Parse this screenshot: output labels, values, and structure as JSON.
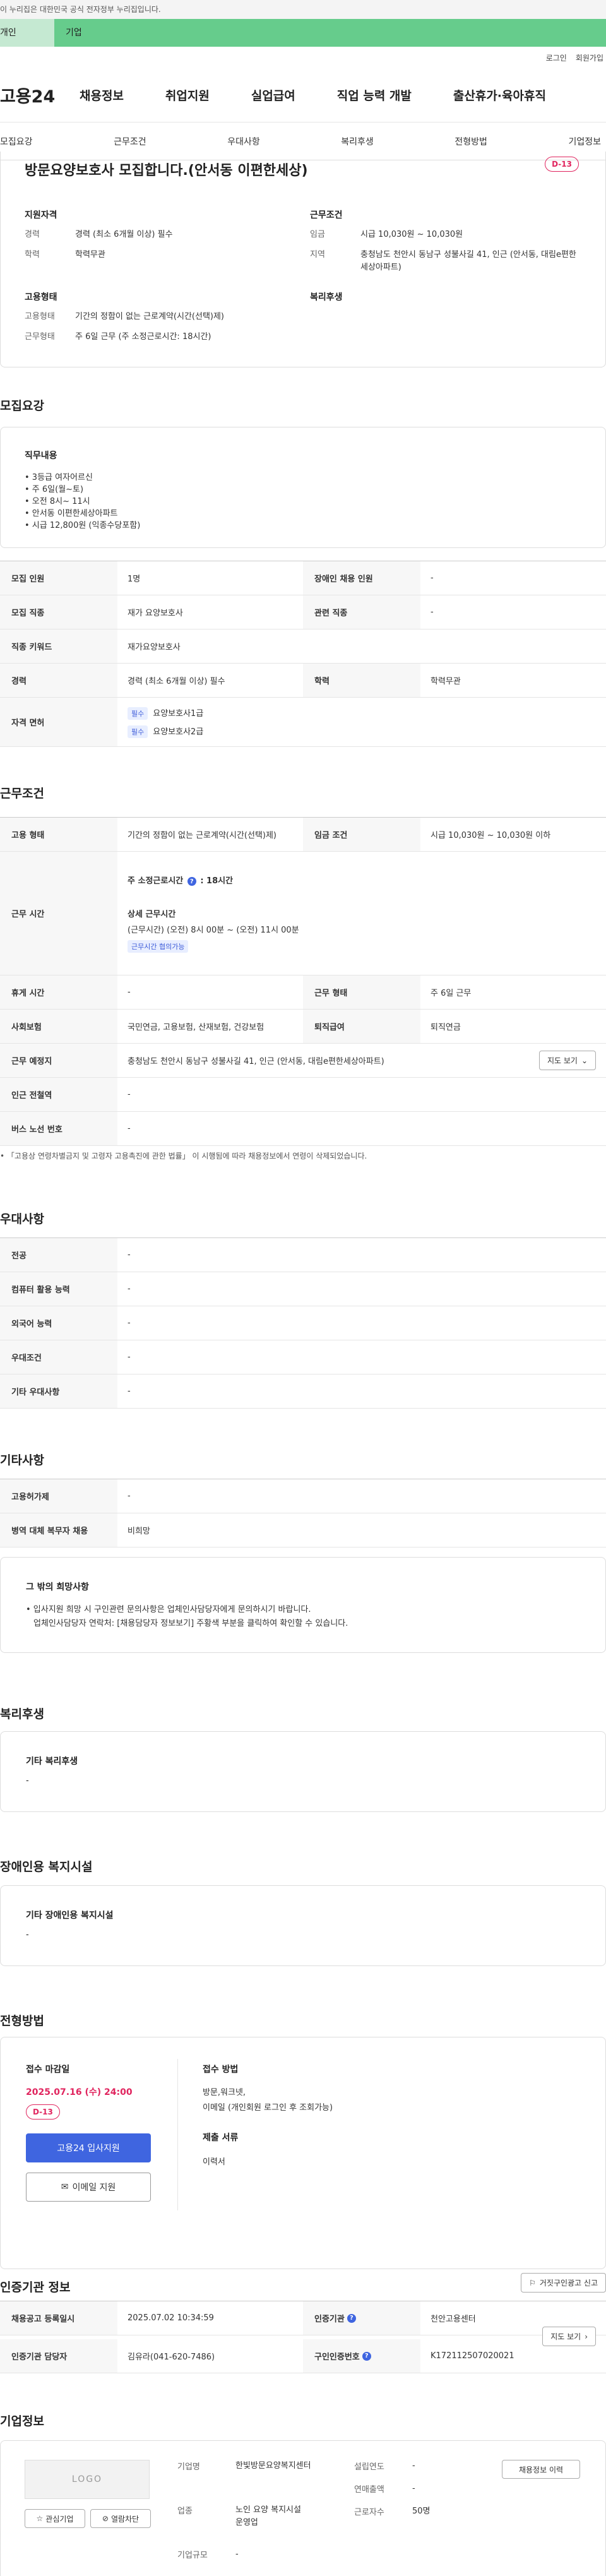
{
  "gov_banner": "이 누리집은 대한민국 공식 전자정부 누리집입니다.",
  "user_tabs": [
    "개인",
    "기업"
  ],
  "top_links": [
    "로그인",
    "회원가입"
  ],
  "logo": "고용24",
  "gnb": [
    "채용정보",
    "취업지원",
    "실업급여",
    "직업 능력 개발",
    "출산휴가·육아휴직"
  ],
  "subnav": [
    "모집요강",
    "근무조건",
    "우대사항",
    "복리후생",
    "전형방법",
    "기업정보"
  ],
  "summary": {
    "title": "방문요양보호사 모집합니다.(안서동 이편한세상)",
    "dday": "D-13",
    "qual_title": "지원자격",
    "qual": [
      {
        "k": "경력",
        "v": "경력 (최소 6개월 이상) 필수"
      },
      {
        "k": "학력",
        "v": "학력무관"
      }
    ],
    "cond_title": "근무조건",
    "cond": [
      {
        "k": "임금",
        "v": "시급 10,030원 ~ 10,030원"
      },
      {
        "k": "지역",
        "v": "충청남도 천안시 동남구 성불사길 41, 인근 (안서동, 대림e편한세상아파트)"
      }
    ],
    "emp_title": "고용형태",
    "emp": [
      {
        "k": "고용형태",
        "v": "기간의 정함이 없는 근로계약(시간(선택)제)"
      },
      {
        "k": "근무형태",
        "v": "주 6일 근무 (주 소정근로시간: 18시간)"
      }
    ],
    "welfare_title": "복리후생"
  },
  "recruit": {
    "title": "모집요강",
    "duty_title": "직무내용",
    "duties": [
      "• 3등급 여자어르신",
      "• 주 6일(월~토)",
      "• 오전 8시~ 11시",
      "• 안서동 이편한세상아파트",
      "• 시급 12,800원 (익종수당포함)"
    ],
    "rows": [
      {
        "k1": "모집 인원",
        "v1": "1명",
        "k2": "장애인 채용 인원",
        "v2": "-"
      },
      {
        "k1": "모집 직종",
        "v1": "재가 요양보호사",
        "k2": "관련 직종",
        "v2": "-"
      }
    ],
    "keyword_label": "직종 키워드",
    "keyword": "재가요양보호사",
    "career_label": "경력",
    "career": "경력 (최소 6개월 이상) 필수",
    "edu_label": "학력",
    "edu": "학력무관",
    "license_label": "자격 면허",
    "licenses": [
      {
        "badge": "필수",
        "name": "요양보호사1급"
      },
      {
        "badge": "필수",
        "name": "요양보호사2급"
      }
    ]
  },
  "work": {
    "title": "근무조건",
    "type_label": "고용 형태",
    "type": "기간의 정함이 없는 근로계약(시간(선택)제)",
    "wage_label": "임금 조건",
    "wage": "시급 10,030원 ~ 10,030원 이하",
    "time_label": "근무 시간",
    "weekly_hours_label": "주 소정근로시간",
    "weekly_hours": ": 18시간",
    "detail_label": "상세 근무시간",
    "detail": "(근무시간) (오전) 8시 00분 ~ (오전) 11시 00분",
    "flex_badge": "근무시간 협의가능",
    "rest_label": "휴게 시간",
    "rest": "-",
    "form_label": "근무 형태",
    "form": "주 6일 근무",
    "insurance_label": "사회보험",
    "insurance": "국민연금, 고용보험, 산재보험, 건강보험",
    "severance_label": "퇴직급여",
    "severance": "퇴직연금",
    "place_label": "근무 예정지",
    "place": "충청남도 천안시 동남구 성불사길 41, 인근 (안서동, 대림e편한세상아파트)",
    "map_button": "지도 보기",
    "subway_label": "인근 전철역",
    "subway": "-",
    "bus_label": "버스 노선 번호",
    "bus": "-",
    "note": "「고용상 연령차별금지 및 고령자 고용촉진에 관한 법률」 이 시행됨에 따라 채용정보에서 연령이 삭제되었습니다."
  },
  "prefer": {
    "title": "우대사항",
    "rows": [
      {
        "k": "전공",
        "v": "-"
      },
      {
        "k": "컴퓨터 활용 능력",
        "v": "-"
      },
      {
        "k": "외국어 능력",
        "v": "-"
      },
      {
        "k": "우대조건",
        "v": "-"
      },
      {
        "k": "기타 우대사항",
        "v": "-"
      }
    ]
  },
  "etc": {
    "title": "기타사항",
    "rows": [
      {
        "k": "고용허가제",
        "v": "-"
      },
      {
        "k": "병역 대체 복무자 채용",
        "v": "비희망"
      }
    ],
    "other_title": "그 밖의 희망사항",
    "other_lines": [
      "• 입사지원 희망 시 구인관련 문의사항은 업체인사담당자에게 문의하시기 바랍니다.",
      "업체인사담당자 연락처: [채용담당자 정보보기] 주황색 부분을 클릭하여 확인할 수 있습니다."
    ]
  },
  "benefit": {
    "title": "복리후생",
    "sub_title": "기타 복리후생",
    "value": "-"
  },
  "disabled": {
    "title": "장애인용 복지시설",
    "sub_title": "기타 장애인용 복지시설",
    "value": "-"
  },
  "selection": {
    "title": "전형방법",
    "deadline_label": "접수 마감일",
    "deadline": "2025.07.16 (수) 24:00",
    "dday": "D-13",
    "apply_button": "고용24 입사지원",
    "email_button": "이메일 지원",
    "method_label": "접수 방법",
    "method": "방문,워크넷,",
    "method2": "이메일 (개인회원 로그인 후 조회가능)",
    "docs_label": "제출 서류",
    "docs": "이력서"
  },
  "agency": {
    "title": "인증기관 정보",
    "report_button": "거짓구인광고 신고",
    "reg_date_label": "채용공고 등록일시",
    "reg_date": "2025.07.02 10:34:59",
    "agency_label": "인증기관",
    "agency": "천안고용센터",
    "map_button": "지도 보기",
    "manager_label": "인증기관 담당자",
    "manager": "김유라(041-620-7486)",
    "cert_no_label": "구인인증번호",
    "cert_no": "K172112507020021"
  },
  "company": {
    "title": "기업정보",
    "logo_text": "LOGO",
    "interest_button": "관심기업",
    "block_button": "열람차단",
    "name_label": "기업명",
    "name": "한빛방문요양복지센터",
    "industry_label": "업종",
    "industry": "노인 요양 복지시설 운영업",
    "scale_label": "기업규모",
    "scale": "-",
    "founded_label": "설립연도",
    "founded": "-",
    "sales_label": "연매출액",
    "sales": "-",
    "employees_label": "근로자수",
    "employees": "50명",
    "history_button": "채용정보 이력"
  }
}
